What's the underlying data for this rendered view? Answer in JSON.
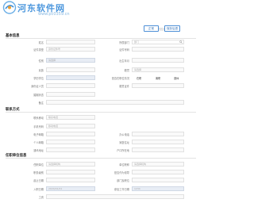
{
  "watermark": {
    "site_name": "河东软件网",
    "url": "www.pc0359.cn"
  },
  "header": {
    "ghost_text": "* 人员姓名",
    "save_label": "正常",
    "confirm_label": "保存后退"
  },
  "basic": {
    "title": "基本信息",
    "fields": [
      {
        "label": "姓名",
        "value": ""
      },
      {
        "label": "所属部门",
        "value": "部门"
      },
      {
        "label": "证件类型",
        "value": "身份证件号"
      },
      {
        "label": "证件号码",
        "value": ""
      },
      {
        "label": "性别",
        "value": "请选择"
      },
      {
        "label": "出生年月",
        "value": ""
      },
      {
        "label": "民族",
        "value": ""
      },
      {
        "label": "籍贯",
        "value": "请选择"
      },
      {
        "label": "学历学位",
        "value": ""
      },
      {
        "label": "身份证人员",
        "value": ""
      },
      {
        "label": "籍贯证件",
        "value": ""
      },
      {
        "label": "婚姻状态",
        "value": ""
      },
      {
        "label": "备注",
        "value": ""
      }
    ],
    "radio_label": "是否在职位情况",
    "radios": [
      "在职",
      "离职",
      "退休"
    ]
  },
  "contact": {
    "title": "联系方式",
    "fields": [
      {
        "label": "联系移动",
        "value": "联系电话"
      },
      {
        "label": "手机号码",
        "value": "移动电话"
      },
      {
        "label": "电子邮箱",
        "value": ""
      },
      {
        "label": "办公电话",
        "value": ""
      },
      {
        "label": "个人邮箱",
        "value": ""
      },
      {
        "label": "家庭住址",
        "value": ""
      },
      {
        "label": "通讯地址",
        "value": ""
      },
      {
        "label": "户口所在地",
        "value": ""
      }
    ]
  },
  "job": {
    "title": "任职单位信息",
    "fields": [
      {
        "label": "任职单位",
        "value": "请选择机构"
      },
      {
        "label": "单位职称",
        "value": "请选择机构"
      },
      {
        "label": "职务级别",
        "value": ""
      },
      {
        "label": "是否作为领导",
        "value": ""
      },
      {
        "label": "起止日期",
        "value": ""
      },
      {
        "label": "部门及职位",
        "value": ""
      },
      {
        "label": "入职日期",
        "value": "2024/01/01"
      },
      {
        "label": "参加工作日期",
        "value": "1234"
      },
      {
        "label": "工资",
        "value": ""
      }
    ]
  }
}
